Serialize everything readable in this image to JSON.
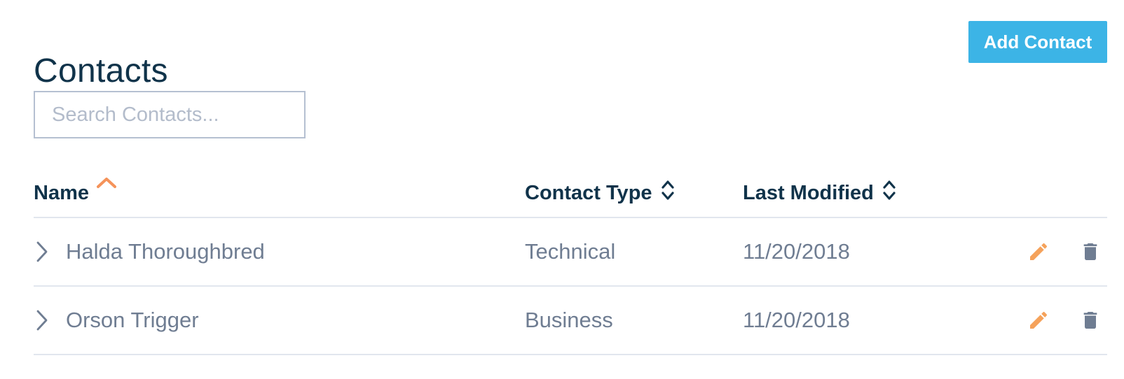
{
  "page": {
    "title": "Contacts"
  },
  "toolbar": {
    "add_label": "Add Contact"
  },
  "search": {
    "placeholder": "Search Contacts...",
    "value": ""
  },
  "table": {
    "columns": [
      {
        "label": "Name",
        "sort": "ascending"
      },
      {
        "label": "Contact Type",
        "sort": "none"
      },
      {
        "label": "Last Modified",
        "sort": "none"
      }
    ],
    "rows": [
      {
        "name": "Halda Thoroughbred",
        "type": "Technical",
        "modified": "11/20/2018"
      },
      {
        "name": "Orson Trigger",
        "type": "Business",
        "modified": "11/20/2018"
      }
    ]
  },
  "icons": {
    "sort_active": "chevron-up-icon",
    "sort_inactive": "sort-icon",
    "expand": "chevron-right-icon",
    "edit": "pencil-icon",
    "delete": "trash-icon"
  },
  "colors": {
    "title": "#10334a",
    "accent_button": "#3cb4e6",
    "sort_active": "#f5935a",
    "edit_icon": "#f5a25b",
    "delete_icon": "#6f7d92",
    "body_text": "#6f7d92",
    "divider": "#e1e6ee",
    "search_border": "#b5c0d1"
  }
}
